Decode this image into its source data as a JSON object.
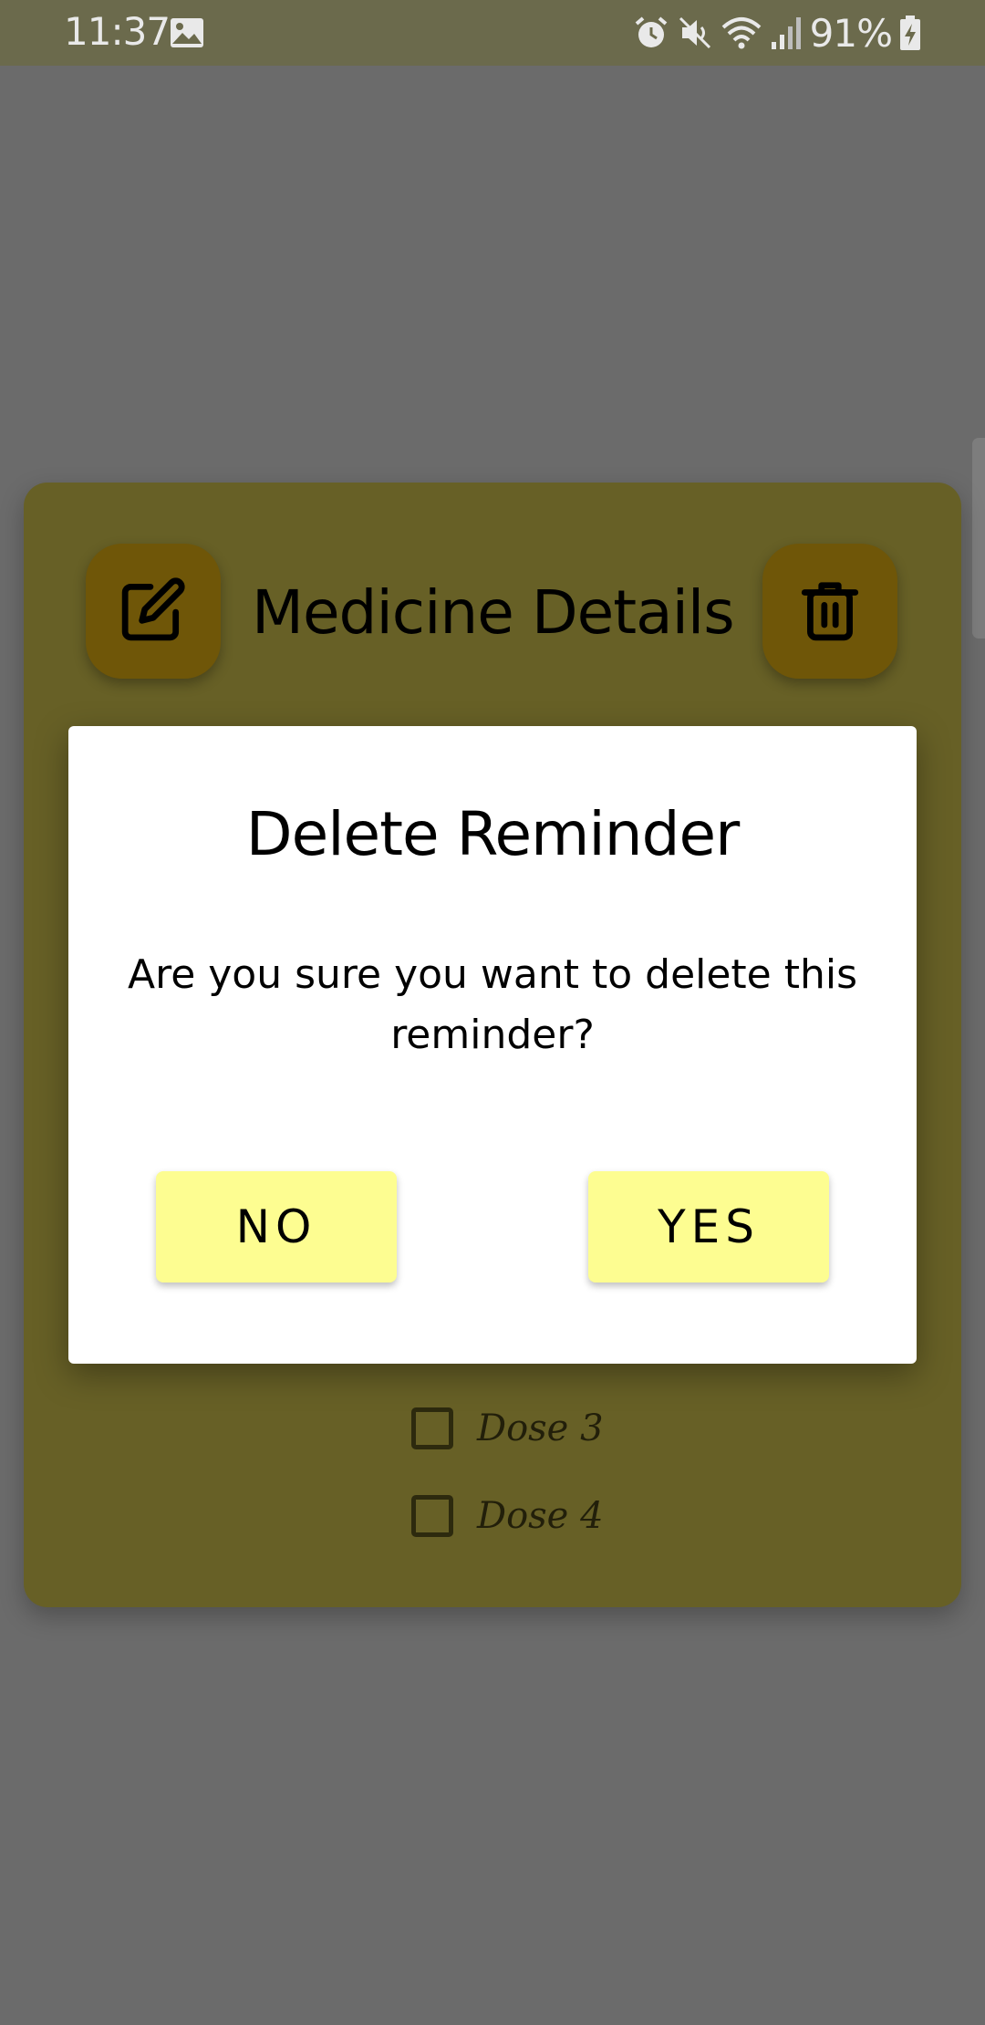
{
  "status_bar": {
    "time": "11:37",
    "battery_percent": "91%",
    "icons": [
      "image-icon",
      "alarm-icon",
      "mute-icon",
      "wifi-icon",
      "signal-icon",
      "battery-charging-icon"
    ]
  },
  "medicine_card": {
    "title": "Medicine Details",
    "edit_icon": "edit-icon",
    "delete_icon": "trash-icon",
    "doses": [
      {
        "label": "Dose 3",
        "checked": false
      },
      {
        "label": "Dose 4",
        "checked": false
      }
    ]
  },
  "dialog": {
    "title": "Delete Reminder",
    "message": "Are you sure you want to delete this reminder?",
    "no_label": "NO",
    "yes_label": "YES"
  },
  "colors": {
    "overlay": "#6b6b6b",
    "card": "#676026",
    "action_button": "#6f5608",
    "dialog_button": "#fdfd91"
  }
}
